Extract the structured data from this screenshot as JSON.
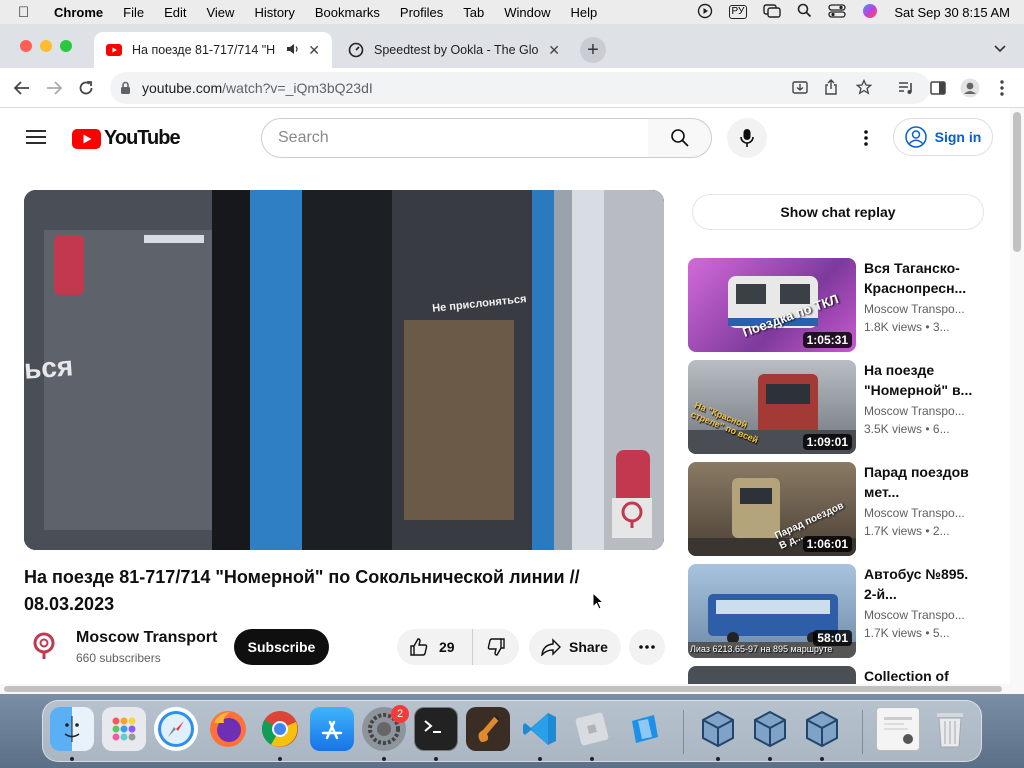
{
  "menubar": {
    "app": "Chrome",
    "items": [
      "File",
      "Edit",
      "View",
      "History",
      "Bookmarks",
      "Profiles",
      "Tab",
      "Window",
      "Help"
    ],
    "keyboard": "РУ",
    "datetime": "Sat Sep 30  8:15 AM"
  },
  "tabs": [
    {
      "title": "На поезде 81-717/714 \"Н",
      "active": true
    },
    {
      "title": "Speedtest by Ookla - The Glo",
      "active": false
    }
  ],
  "address": {
    "host": "youtube.com",
    "path": "/watch?v=_iQm3bQ23dI"
  },
  "youtube": {
    "logo_text": "YouTube",
    "search_placeholder": "Search",
    "sign_in": "Sign in"
  },
  "video": {
    "title": "На поезде 81-717/714 \"Номерной\" по Сокольнической линии // 08.03.2023",
    "overlay_left": "ься",
    "overlay_sign": "Не прислоняться",
    "channel": "Moscow Transport",
    "subscribers": "660 subscribers",
    "subscribe_label": "Subscribe",
    "likes": "29",
    "share_label": "Share"
  },
  "sidebar": {
    "chat_replay": "Show chat replay",
    "recommendations": [
      {
        "title": "Вся Таганско-Краснопресн...",
        "channel": "Moscow Transpo...",
        "views": "1.8K views",
        "age": "3...",
        "duration": "1:05:31",
        "thumb_text": "Поездка по ТКЛ",
        "thumb_color": "#b04fc0"
      },
      {
        "title": "На поезде \"Номерной\" в...",
        "channel": "Moscow Transpo...",
        "views": "3.5K views",
        "age": "6...",
        "duration": "1:09:01",
        "thumb_text": "На \"Красной стреле\" по всей",
        "thumb_color": "#8a8f96"
      },
      {
        "title": "Парад поездов мет...",
        "channel": "Moscow Transpo...",
        "views": "1.7K views",
        "age": "2...",
        "duration": "1:06:01",
        "thumb_text": "Парад поездов В д...",
        "thumb_color": "#6b5c48"
      },
      {
        "title": "Автобус №895. 2-й...",
        "channel": "Moscow Transpo...",
        "views": "1.7K views",
        "age": "5...",
        "duration": "58:01",
        "thumb_text": "Лиаз 6213.65-97 на 895 маршруте",
        "thumb_color": "#5b7fa6"
      },
      {
        "title": "Collection of",
        "channel": "",
        "views": "",
        "age": "",
        "duration": "",
        "thumb_text": "",
        "thumb_color": "#4a4f55"
      }
    ]
  },
  "dock": {
    "system_settings_badge": "2",
    "apps": [
      "finder-icon",
      "launchpad-icon",
      "safari-icon",
      "firefox-icon",
      "chrome-icon",
      "app-store-icon",
      "system-settings-icon",
      "terminal-icon",
      "garageband-icon",
      "vscode-icon",
      "roblox-icon",
      "roblox-studio-icon",
      "virtualbox-icon",
      "virtualbox-icon",
      "virtualbox-icon",
      "preview-icon",
      "trash-icon"
    ]
  }
}
